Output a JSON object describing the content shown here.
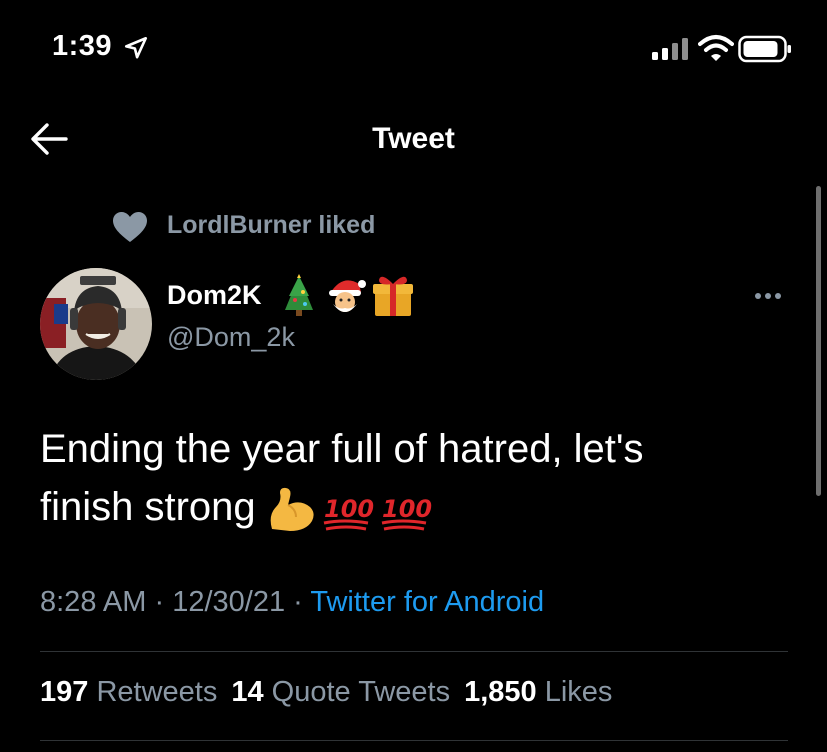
{
  "status_bar": {
    "time": "1:39"
  },
  "header": {
    "title": "Tweet",
    "back_icon": "arrow-left-icon"
  },
  "social_context": {
    "icon": "heart-icon",
    "text": "LordlBurner liked"
  },
  "tweet": {
    "author": {
      "name": "Dom2K",
      "name_emojis": [
        "christmas-tree",
        "santa",
        "gift"
      ],
      "handle": "@Dom_2k"
    },
    "text_line1": "Ending the year full of hatred, let's",
    "text_line2": "finish strong",
    "text_emojis": [
      "flexed-biceps",
      "hundred-points",
      "hundred-points"
    ],
    "time": "8:28 AM",
    "date": "12/30/21",
    "separator": "·",
    "source": "Twitter for Android"
  },
  "stats": {
    "retweets": {
      "count": "197",
      "label": "Retweets"
    },
    "quote_tweets": {
      "count": "14",
      "label": "Quote Tweets"
    },
    "likes": {
      "count": "1,850",
      "label": "Likes"
    }
  },
  "colors": {
    "background": "#000000",
    "primary_text": "#ffffff",
    "secondary_text": "#8b98a5",
    "link": "#1d9bf0",
    "divider": "#2f3336"
  }
}
